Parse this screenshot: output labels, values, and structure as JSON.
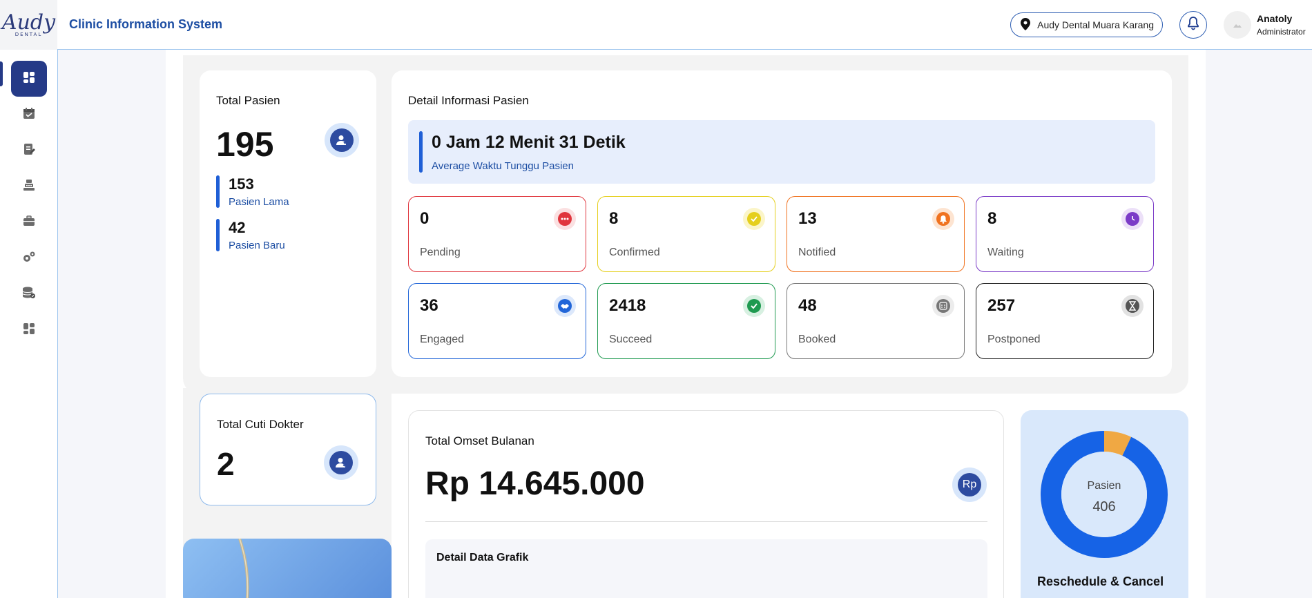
{
  "header": {
    "logo_text": "Audy",
    "logo_sub": "DENTAL",
    "app_title": "Clinic Information System",
    "clinic_name": "Audy Dental Muara Karang",
    "user_name": "Anatoly",
    "user_role": "Administrator"
  },
  "sidebar": {
    "items": [
      {
        "icon": "dashboard-icon",
        "active": true
      },
      {
        "icon": "calendar-icon",
        "active": false
      },
      {
        "icon": "edit-document-icon",
        "active": false
      },
      {
        "icon": "cashier-icon",
        "active": false
      },
      {
        "icon": "briefcase-icon",
        "active": false
      },
      {
        "icon": "settings-gears-icon",
        "active": false
      },
      {
        "icon": "database-icon",
        "active": false
      },
      {
        "icon": "grid-icon",
        "active": false
      }
    ]
  },
  "total_pasien": {
    "title": "Total Pasien",
    "value": "195",
    "lama_value": "153",
    "lama_label": "Pasien Lama",
    "baru_value": "42",
    "baru_label": "Pasien Baru"
  },
  "detail_info": {
    "title": "Detail Informasi Pasien",
    "wait_time": "0 Jam 12 Menit 31 Detik",
    "wait_label": "Average Waktu Tunggu Pasien",
    "statuses": [
      {
        "value": "0",
        "label": "Pending",
        "color": "#e0353d",
        "icon": "more-dots-icon"
      },
      {
        "value": "8",
        "label": "Confirmed",
        "color": "#e5cf1c",
        "icon": "check-circle-icon"
      },
      {
        "value": "13",
        "label": "Notified",
        "color": "#f0721f",
        "icon": "bell-icon"
      },
      {
        "value": "8",
        "label": "Waiting",
        "color": "#7b3bc7",
        "icon": "clock-icon"
      },
      {
        "value": "36",
        "label": "Engaged",
        "color": "#2266d8",
        "icon": "handshake-icon"
      },
      {
        "value": "2418",
        "label": "Succeed",
        "color": "#1f9a50",
        "icon": "check-icon"
      },
      {
        "value": "48",
        "label": "Booked",
        "color": "#777777",
        "icon": "calendar-grid-icon"
      },
      {
        "value": "257",
        "label": "Postponed",
        "color": "#222222",
        "icon": "hourglass-icon"
      }
    ]
  },
  "cuti_dokter": {
    "title": "Total Cuti Dokter",
    "value": "2"
  },
  "omset": {
    "title": "Total Omset Bulanan",
    "value": "Rp 14.645.000",
    "currency_icon_text": "Rp",
    "detail_title": "Detail Data Grafik"
  },
  "donut": {
    "title": "Reschedule & Cancel",
    "center_label": "Pasien",
    "center_value": "406"
  },
  "chart_data": {
    "type": "pie",
    "title": "Reschedule & Cancel",
    "total": 406,
    "series": [
      {
        "value": 0.93,
        "color": "#1663e6"
      },
      {
        "value": 0.07,
        "color": "#f0a843"
      }
    ]
  }
}
